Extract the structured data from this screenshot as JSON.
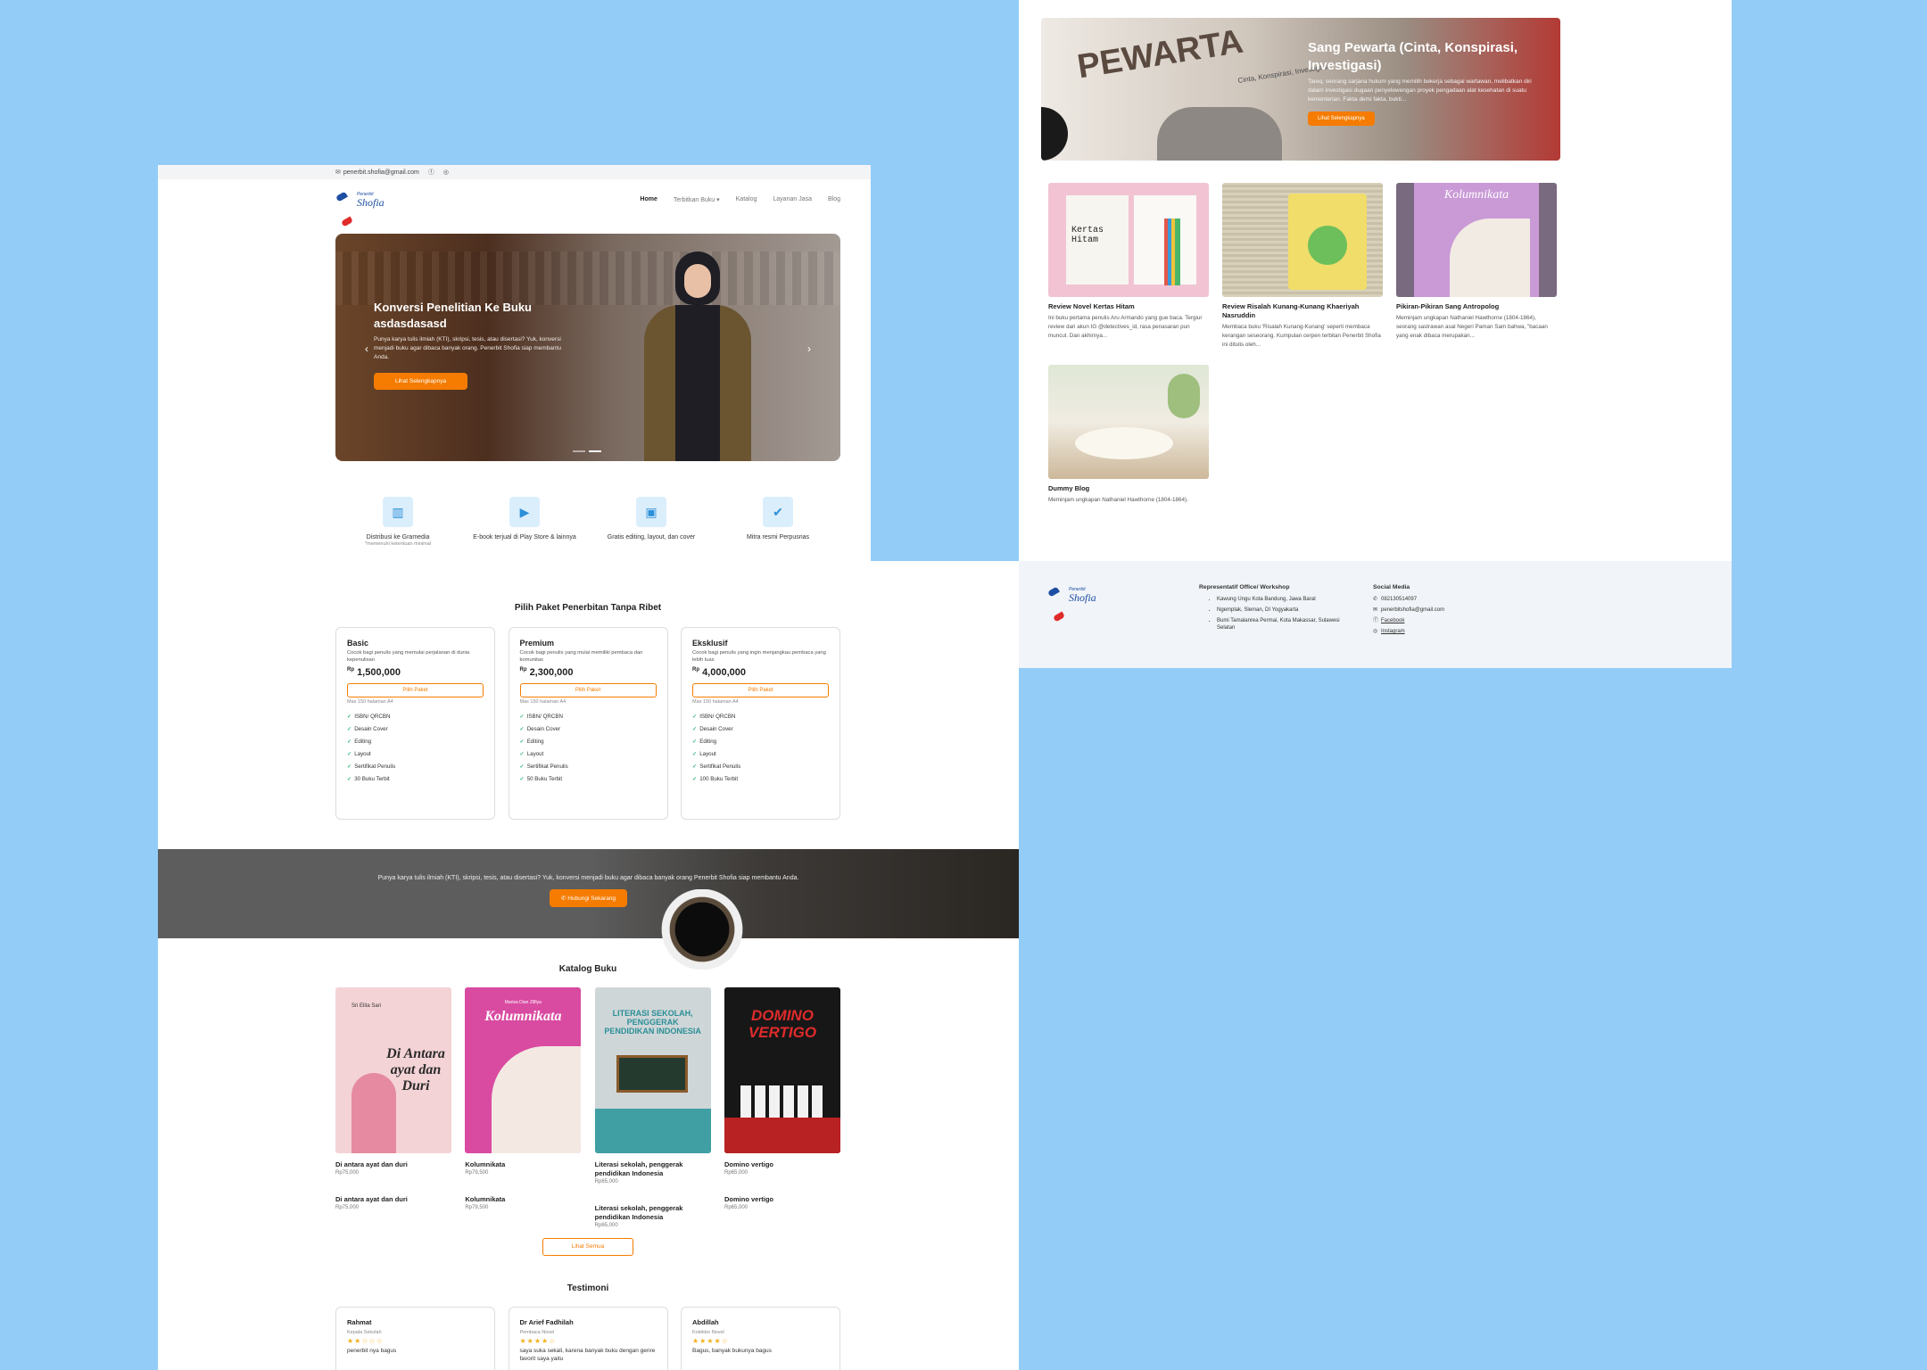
{
  "topbar": {
    "email": "penerbit.shofia@gmail.com",
    "icons": [
      "envelope-icon",
      "facebook-icon",
      "instagram-icon"
    ]
  },
  "brand": {
    "small": "Penerbit",
    "big": "Shofia"
  },
  "nav": [
    {
      "label": "Home"
    },
    {
      "label": "Terbitkan Buku ▾"
    },
    {
      "label": "Katalog"
    },
    {
      "label": "Layanan Jasa"
    },
    {
      "label": "Blog"
    }
  ],
  "hero": {
    "title": "Konversi Penelitian Ke Buku asdasdasasd",
    "text": "Punya karya tulis ilmiah (KTI), skripsi, tesis, atau disertasi? Yuk, konversi menjadi buku agar dibaca banyak orang. Penerbit Shofia siap membantu Anda.",
    "button": "Lihat Selengkapnya",
    "prev": "‹",
    "next": "›"
  },
  "features": [
    {
      "icon": "books-icon",
      "title": "Distribusi ke Gramedia",
      "sub": "*memenuhi ketentuan minimal"
    },
    {
      "icon": "play-store-icon",
      "title": "E-book terjual di Play Store & lainnya",
      "sub": ""
    },
    {
      "icon": "image-edit-icon",
      "title": "Gratis editing, layout, dan cover",
      "sub": ""
    },
    {
      "icon": "verified-check-icon",
      "title": "Mitra resmi Perpusnas",
      "sub": ""
    }
  ],
  "packages_title": "Pilih Paket Penerbitan Tanpa Ribet",
  "packages": [
    {
      "name": "Basic",
      "desc": "Cocok bagi penulis yang memulai perjalanan di dunia kepenulisan",
      "currency": "Rp",
      "price": "1,500,000",
      "button": "Pilih Paket",
      "max": "Max 150 halaman A4",
      "features": [
        "ISBN/ QRCBN",
        "Desain Cover",
        "Editing",
        "Layout",
        "Sertifikat Penulis",
        "30 Buku Terbit"
      ]
    },
    {
      "name": "Premium",
      "desc": "Cocok bagi penulis yang mulai memiliki pembaca dan komunitas",
      "currency": "Rp",
      "price": "2,300,000",
      "button": "Pilih Paket",
      "max": "Max 150 halaman A4",
      "features": [
        "ISBN/ QRCBN",
        "Desain Cover",
        "Editing",
        "Layout",
        "Sertifikat Penulis",
        "50 Buku Terbit"
      ]
    },
    {
      "name": "Eksklusif",
      "desc": "Cocok bagi penulis yang ingin menjangkau pembaca yang lebih luas",
      "currency": "Rp",
      "price": "4,000,000",
      "button": "Pilih Paket",
      "max": "Max 150 halaman A4",
      "features": [
        "ISBN/ QRCBN",
        "Desain Cover",
        "Editing",
        "Layout",
        "Sertifikat Penulis",
        "100 Buku Terbit"
      ]
    }
  ],
  "cta": {
    "text": "Punya karya tulis ilmiah (KTI), skripsi, tesis, atau disertasi? Yuk, konversi menjadi buku agar dibaca banyak orang Penerbit Shofia siap membantu Anda.",
    "button": "✆ Hubungi Sekarang"
  },
  "catalog_title": "Katalog Buku",
  "books": [
    {
      "title": "Di antara ayat dan duri",
      "price": "Rp75,000",
      "cover_text": "Di Antara ayat dan Duri",
      "cover_author": "Sri Elita Sari",
      "cover_bg": "#f4d3d6",
      "cover_fg": "#2b2b2b"
    },
    {
      "title": "Kolumnikata",
      "price": "Rp79,500",
      "cover_text": "Kolumnikata",
      "cover_author": "Marisa Dian Zilfiya",
      "cover_bg": "#d94aa1",
      "cover_fg": "#ffffff"
    },
    {
      "title": "Literasi sekolah, penggerak pendidikan Indonesia",
      "price": "Rp65,000",
      "cover_text": "LITERASI SEKOLAH, PENGGERAK PENDIDIKAN INDONESIA",
      "cover_author": "",
      "cover_bg": "#3f9fa3",
      "cover_fg": "#ffffff"
    },
    {
      "title": "Domino vertigo",
      "price": "Rp65,000",
      "cover_text": "DOMINO VERTIGO",
      "cover_author": "",
      "cover_bg": "#171717",
      "cover_fg": "#e02b2b"
    }
  ],
  "see_all": "Lihat Semua",
  "testimoni_title": "Testimoni",
  "testimonials": [
    {
      "name": "Rahmat",
      "role": "Kepala Sekolah",
      "rating": 2,
      "stars": "★★☆☆☆",
      "quote": "penerbit nya bagus"
    },
    {
      "name": "Dr Arief Fadhilah",
      "role": "Pembaca Novel",
      "rating": 4,
      "stars": "★★★★☆",
      "quote": "saya suka sekali, karena banyak buku dengan genre favorit saya yaitu"
    },
    {
      "name": "Abdillah",
      "role": "Kolektor Novel",
      "rating": 4,
      "stars": "★★★★☆",
      "quote": "Bagus, banyak bukunya bagus"
    }
  ],
  "blog_hero": {
    "title": "Sang Pewarta (Cinta, Konspirasi, Investigasi)",
    "text": "Tareq, seorang sarjana hukum yang memilih bekerja sebagai wartawan, melibatkan diri dalam investigasi dugaan penyelewengan proyek pengadaan alat kesehatan di suatu kementerian. Fakta demi fakta, bukti...",
    "button": "Lihat Selengkapnya",
    "cover_text": "PEWARTA",
    "cover_sub": "Cinta, Konspirasi, Investigasi"
  },
  "posts": [
    {
      "title": "Review Novel Kertas Hitam",
      "desc": "Ini buku pertama penulis Aru Armando yang gue baca. Tergiur review dari akun IG @detectives_id, rasa penasaran pun muncul. Dan akhirnya...",
      "img_bg": "#f2c4d3",
      "img_label": "Kertas Hitam"
    },
    {
      "title": "Review Risalah Kunang-Kunang Khaeriyah Nasruddin",
      "desc": "Membaca buku 'Risalah Kunang-Kunang' seperti membaca kerangan seseorang. Kumpulan cerpen terbitan Penerbit Shofia ini ditulis oleh...",
      "img_bg": "#c9c0a7",
      "img_label": ""
    },
    {
      "title": "Pikiran-Pikiran Sang Antropolog",
      "desc": "Meminjam ungkapan Nathaniel Hawthorne (1804-1864), seorang sastrawan asal Negeri Paman Sam bahwa, \"bacaan yang enak dibaca merupakan...",
      "img_bg": "#c99ad6",
      "img_label": "Kolumnikata"
    },
    {
      "title": "Dummy Blog",
      "desc": "Meminjam ungkapan Nathaniel Hawthorne (1804-1864).",
      "img_bg": "#e8e2d4",
      "img_label": ""
    }
  ],
  "footer": {
    "office_title": "Representatif Office/ Workshop",
    "offices": [
      "Kawung Ungu Kota Bandung, Jawa Barat",
      "Ngemplak, Sleman, DI Yogyakarta",
      "Bumi Tamalanrea Permai, Kota Makassar, Sulawesi Selatan"
    ],
    "social_title": "Social Media",
    "social": [
      {
        "icon": "whatsapp-icon",
        "glyph": "✆",
        "label": "082130514097"
      },
      {
        "icon": "envelope-icon",
        "glyph": "✉",
        "label": "penerbitshofia@gmail.com"
      },
      {
        "icon": "facebook-icon",
        "glyph": "ⓕ",
        "label": "Facebook"
      },
      {
        "icon": "instagram-icon",
        "glyph": "◎",
        "label": "Instagram"
      }
    ]
  },
  "colors": {
    "accent": "#f57c00",
    "brand": "#1d4ea3",
    "background": "#93ccf7",
    "check": "#2bb673",
    "star": "#f2b01e"
  }
}
